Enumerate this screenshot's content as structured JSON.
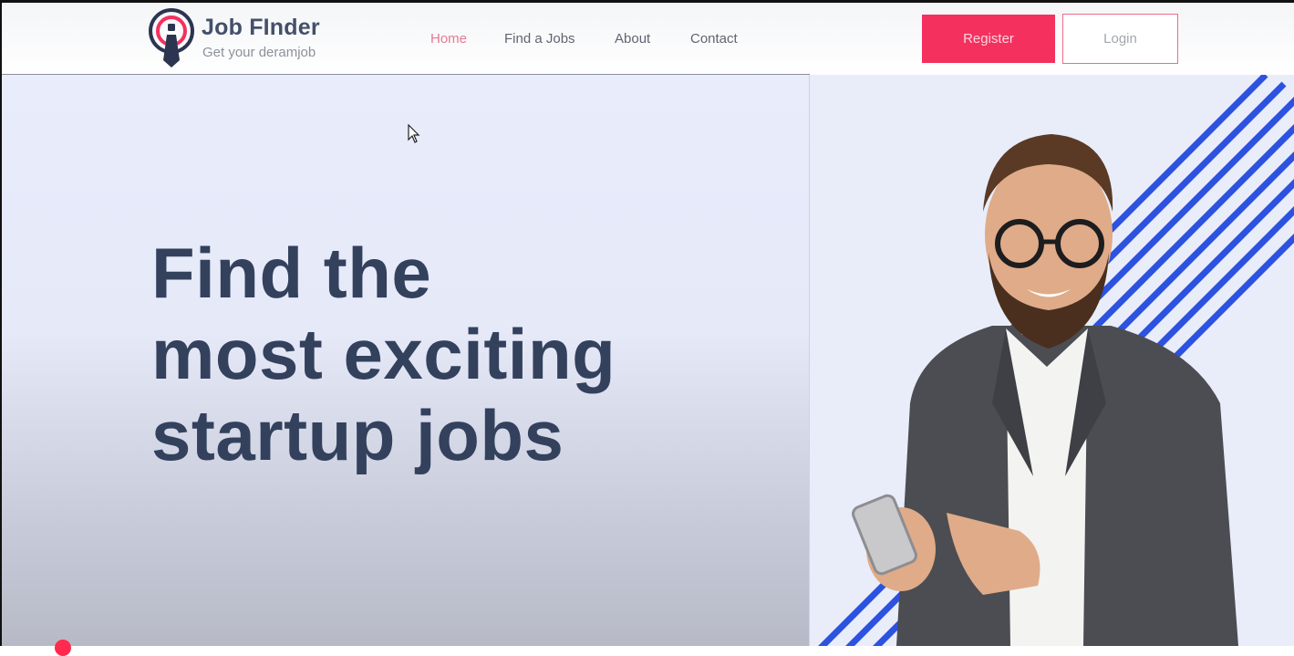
{
  "brand": {
    "title": "Job FInder",
    "tagline": "Get your deramjob"
  },
  "nav": {
    "items": [
      {
        "label": "Home",
        "active": true
      },
      {
        "label": "Find a Jobs",
        "active": false
      },
      {
        "label": "About",
        "active": false
      },
      {
        "label": "Contact",
        "active": false
      }
    ]
  },
  "auth": {
    "register_label": "Register",
    "login_label": "Login"
  },
  "hero": {
    "headline_lines": [
      "Find the",
      "most exciting",
      "startup jobs"
    ],
    "image_subject": "smiling bearded man in glasses and grey blazer holding a smartphone"
  },
  "colors": {
    "accent": "#f4305f",
    "heading": "#33415d",
    "stripe": "#2d52e0",
    "hero_bg": "#e8ecfb"
  },
  "icons": [
    "job-finder-logo-icon",
    "mouse-cursor-icon"
  ]
}
